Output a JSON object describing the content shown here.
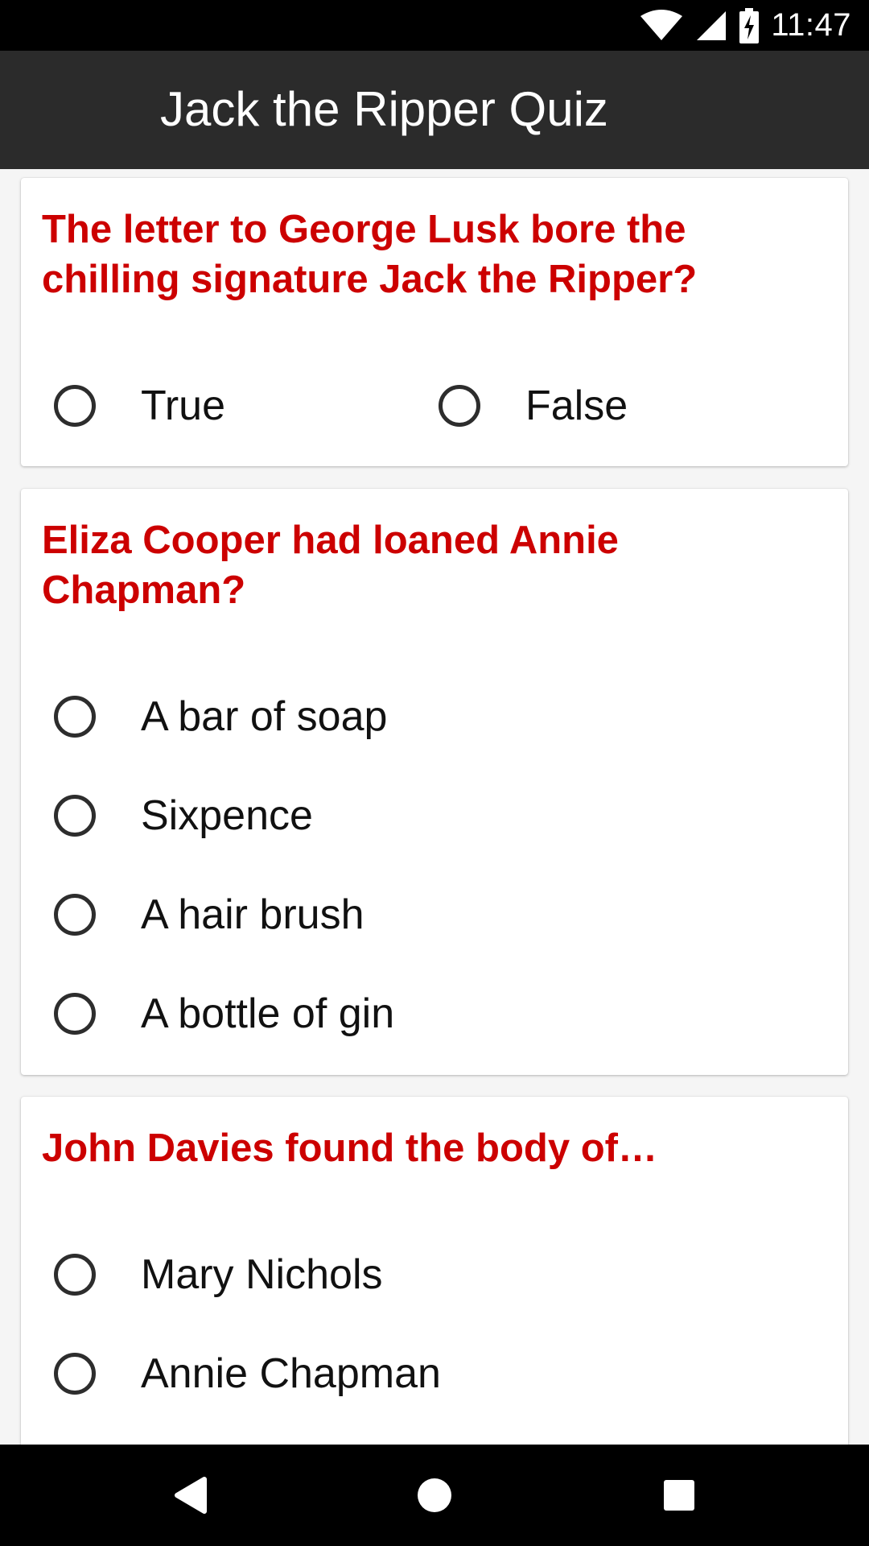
{
  "status_bar": {
    "time": "11:47",
    "icons": [
      "wifi-icon",
      "cell-signal-icon",
      "battery-charging-icon"
    ]
  },
  "app_bar": {
    "title": "Jack the Ripper Quiz"
  },
  "questions": [
    {
      "text": "The letter to George Lusk bore the chilling signature Jack the Ripper?",
      "options": [
        "True",
        "False"
      ],
      "selected": null
    },
    {
      "text": "Eliza Cooper had loaned Annie Chapman?",
      "options": [
        "A bar of soap",
        "Sixpence",
        "A hair brush",
        "A bottle of gin"
      ],
      "selected": null
    },
    {
      "text": "John Davies found the body of…",
      "options": [
        "Mary Nichols",
        "Annie Chapman"
      ],
      "selected": null
    }
  ],
  "nav_bar": {
    "buttons": [
      "back-icon",
      "home-icon",
      "recents-icon"
    ]
  },
  "colors": {
    "question_text": "#cc0000",
    "app_bar": "#2b2b2b",
    "background": "#f5f5f5"
  }
}
